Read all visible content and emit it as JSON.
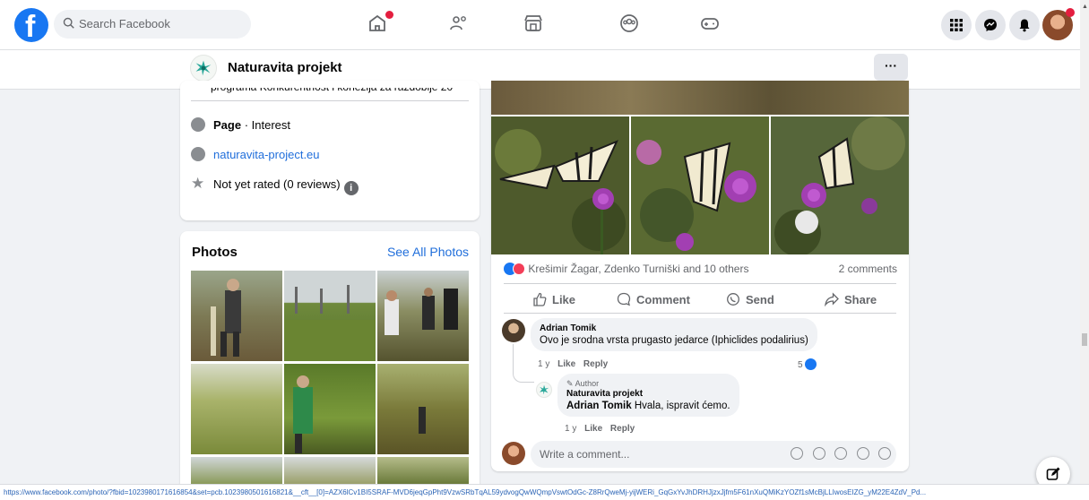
{
  "topbar": {
    "search_placeholder": "Search Facebook",
    "nav": [
      "home-icon",
      "friends-icon",
      "marketplace-icon",
      "groups-icon",
      "gaming-icon"
    ],
    "right": [
      "menu-icon",
      "messenger-icon",
      "notifications-icon",
      "profile-avatar"
    ]
  },
  "page": {
    "name": "Naturavita projekt",
    "more_label": "···"
  },
  "intro": {
    "cut_text": "programa Konkurentnost i kohezija za razdoblje 20",
    "category_bold": "Page",
    "category_rest": " · Interest",
    "website": "naturavita-project.eu",
    "rating": "Not yet rated (0 reviews)",
    "info_icon": "i"
  },
  "photos": {
    "title": "Photos",
    "see_all": "See All Photos"
  },
  "post": {
    "reactors": "Krešimir Žagar, Zdenko Turniški and 10 others",
    "comments_count": "2 comments",
    "actions": [
      "Like",
      "Comment",
      "Send",
      "Share"
    ],
    "comments": [
      {
        "author": "Adrian Tomik",
        "text": "Ovo je srodna vrsta prugasto jedarce (Iphiclides podalirius)",
        "age": "1 y",
        "like": "Like",
        "reply": "Reply",
        "likes": "5"
      },
      {
        "badge": "Author",
        "author": "Naturavita projekt",
        "mention": "Adrian Tomik",
        "text": " Hvala, ispravit ćemo.",
        "age": "1 y",
        "like": "Like",
        "reply": "Reply"
      }
    ],
    "write_placeholder": "Write a comment..."
  },
  "status_url": "https://www.facebook.com/photo/?fbid=1023980171616854&set=pcb.1023980501616821&__cft__[0]=AZX6lCv1BI5SRAF-MVD6jeqGpPht9VzwSRbTqAL59ydvogQwWQmpVswtOdGc-Z8RrQweMj-yijWERi_GqGxYvJhDRHJjzxJjfm5F61nXuQMiKzYOZf1sMcBjLLIwosEIZG_yM22E4ZdV_Pd..."
}
